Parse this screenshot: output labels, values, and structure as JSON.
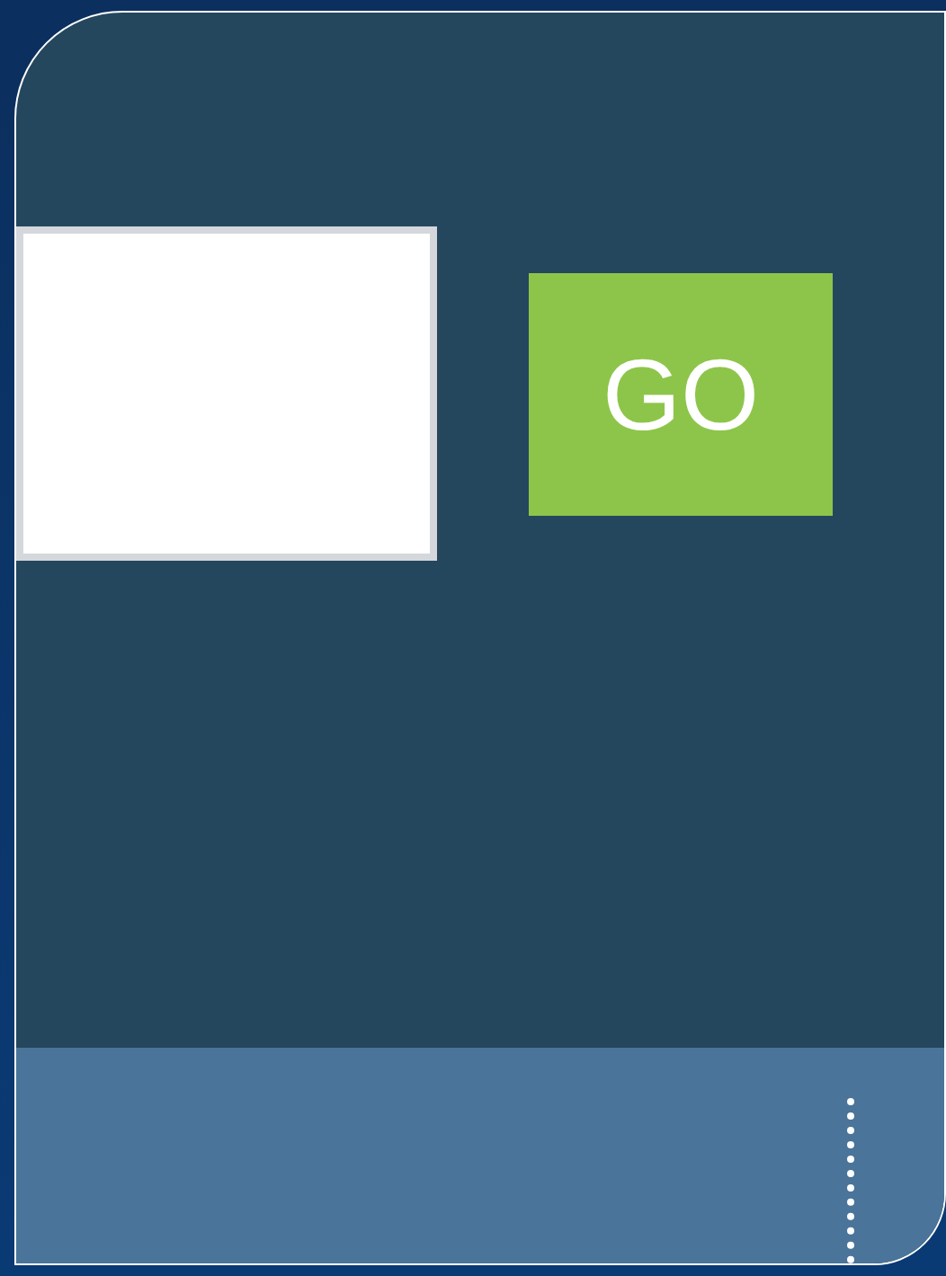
{
  "go_button": {
    "label": "GO"
  }
}
